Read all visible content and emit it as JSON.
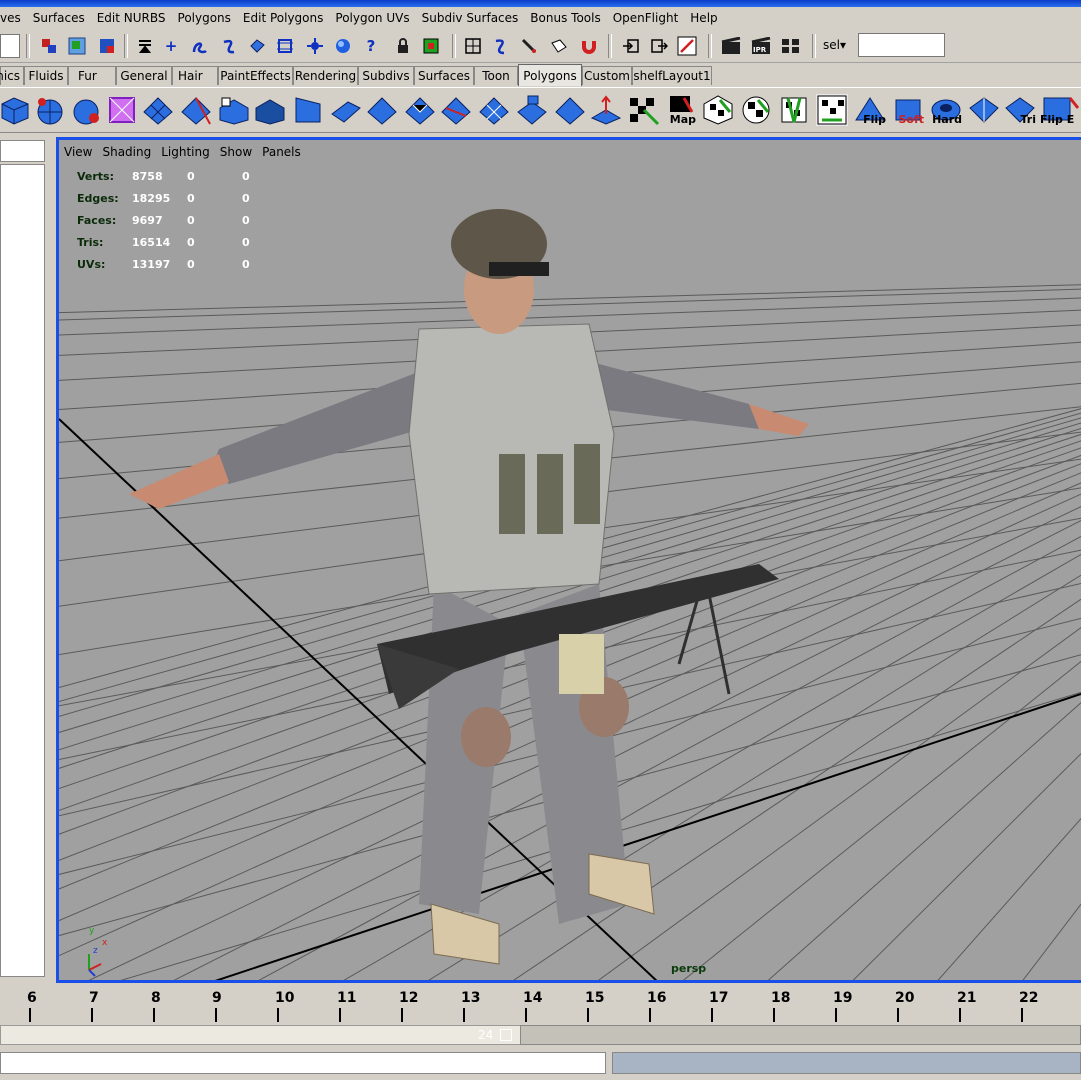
{
  "menu": [
    "ves",
    "Surfaces",
    "Edit NURBS",
    "Polygons",
    "Edit Polygons",
    "Polygon UVs",
    "Subdiv Surfaces",
    "Bonus Tools",
    "OpenFlight",
    "Help"
  ],
  "toolbar": {
    "sel_label": "sel▾",
    "icons": [
      "select-by-hierarchy-icon",
      "select-by-object-icon",
      "select-by-component-icon",
      "snap-menu-icon",
      "snap-to-grid-icon",
      "snap-to-curve-icon",
      "snap-to-point-icon",
      "snap-to-view-plane-icon",
      "make-live-icon",
      "history-icon",
      "render-icon",
      "help-icon",
      "lock-icon",
      "selection-mask-icon",
      "input-ops-icon",
      "construction-history-icon",
      "paint-icon",
      "magnet-icon",
      "input-icon",
      "output-icon",
      "pin-icon",
      "render-frame-icon",
      "ipr-render-icon",
      "render-globals-icon"
    ]
  },
  "shelf_tabs": [
    "mics",
    "Fluids",
    "Fur",
    "General",
    "Hair",
    "PaintEffects",
    "Rendering",
    "Subdivs",
    "Surfaces",
    "Toon",
    "Polygons",
    "Custom",
    "shelfLayout1"
  ],
  "shelf_active": "Polygons",
  "shelf_labels": {
    "map": "Map",
    "flip": "Flip",
    "soft": "Soft",
    "hard": "Hard",
    "tri": "Tri",
    "flip_e": "Flip E"
  },
  "viewport": {
    "menu": [
      "View",
      "Shading",
      "Lighting",
      "Show",
      "Panels"
    ],
    "hud": [
      {
        "label": "Verts:",
        "v1": "8758",
        "v2": "0",
        "v3": "0"
      },
      {
        "label": "Edges:",
        "v1": "18295",
        "v2": "0",
        "v3": "0"
      },
      {
        "label": "Faces:",
        "v1": "9697",
        "v2": "0",
        "v3": "0"
      },
      {
        "label": "Tris:",
        "v1": "16514",
        "v2": "0",
        "v3": "0"
      },
      {
        "label": "UVs:",
        "v1": "13197",
        "v2": "0",
        "v3": "0"
      }
    ],
    "camera": "persp",
    "axis_y": "y",
    "axis_x": "x",
    "axis_z": "z",
    "background": "#a0a0a0",
    "frame_color": "#1a50e8"
  },
  "timeline": {
    "ticks": [
      "6",
      "7",
      "8",
      "9",
      "10",
      "11",
      "12",
      "13",
      "14",
      "15",
      "16",
      "17",
      "18",
      "19",
      "20",
      "21",
      "22"
    ],
    "range_end": "24"
  }
}
